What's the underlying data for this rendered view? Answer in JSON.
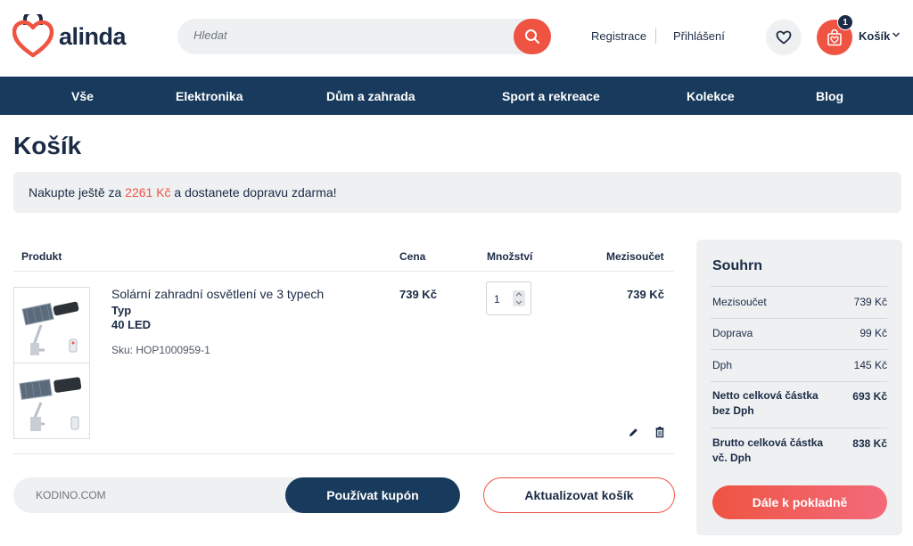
{
  "brand": {
    "name": "alinda",
    "accent": "#ef5443",
    "navy": "#183a5c"
  },
  "search": {
    "placeholder": "Hledat",
    "button_icon": "search-icon"
  },
  "auth": {
    "register": "Registrace",
    "login": "Přihlášení"
  },
  "wishlist": {
    "icon": "heart-icon"
  },
  "cart": {
    "label": "Košík",
    "count": "1",
    "icon": "shopping-bag-icon"
  },
  "nav": {
    "items": [
      {
        "label": "Vše"
      },
      {
        "label": "Elektronika"
      },
      {
        "label": "Dům a zahrada"
      },
      {
        "label": "Sport a rekreace"
      },
      {
        "label": "Kolekce"
      },
      {
        "label": "Blog"
      }
    ]
  },
  "page": {
    "title": "Košík"
  },
  "notice": {
    "before": "Nakupte ještě za ",
    "amount": "2261 Kč",
    "after": " a dostanete dopravu zdarma!"
  },
  "table": {
    "headers": {
      "product": "Produkt",
      "price": "Cena",
      "quantity": "Množství",
      "subtotal": "Mezisoučet"
    },
    "rows": [
      {
        "name": "Solární zahradní osvětlení ve 3 typech",
        "variant_label": "Typ",
        "variant_value": "40 LED",
        "sku": "Sku: HOP1000959-1",
        "price": "739 Kč",
        "quantity": "1",
        "subtotal": "739 Kč"
      }
    ]
  },
  "coupon": {
    "placeholder": "KODINO.COM",
    "apply_label": "Používat kupón"
  },
  "update_cart_label": "Aktualizovat košík",
  "summary": {
    "title": "Souhrn",
    "rows": [
      {
        "label": "Mezisoučet",
        "value": "739 Kč"
      },
      {
        "label": "Doprava",
        "value": "99 Kč"
      },
      {
        "label": "Dph",
        "value": "145 Kč"
      },
      {
        "label": "Netto celková částka bez Dph",
        "value": "693 Kč"
      },
      {
        "label": "Brutto celková částka vč. Dph",
        "value": "838 Kč"
      }
    ],
    "checkout_label": "Dále k pokladně"
  }
}
